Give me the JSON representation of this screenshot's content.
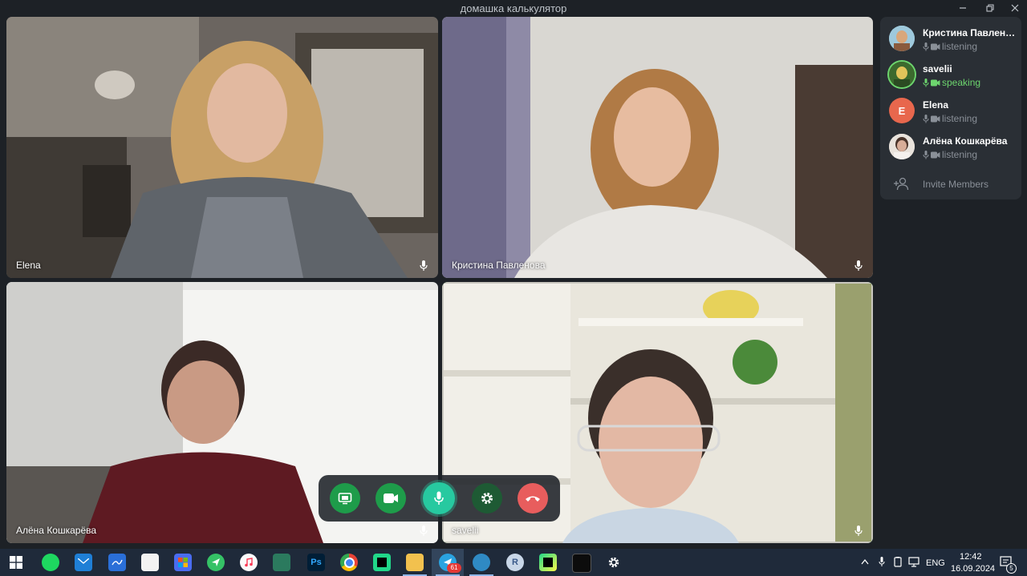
{
  "window": {
    "title": "домашка калькулятор"
  },
  "tiles": [
    {
      "name": "Elena"
    },
    {
      "name": "Кристина Павленова"
    },
    {
      "name": "Алёна Кошкарёва"
    },
    {
      "name": "savelii"
    }
  ],
  "members": [
    {
      "name": "Кристина Павленова",
      "status": "listening"
    },
    {
      "name": "savelii",
      "status": "speaking"
    },
    {
      "name": "Elena",
      "status": "listening",
      "initial": "E"
    },
    {
      "name": "Алёна Кошкарёва",
      "status": "listening"
    }
  ],
  "invite_label": "Invite Members",
  "controls": {
    "share_screen": "share-screen-icon",
    "camera": "video-camera-icon",
    "microphone": "microphone-icon",
    "settings": "gear-icon",
    "end_call": "hang-up-icon"
  },
  "colors": {
    "speaking_accent": "#6dd56e",
    "end_call": "#e85d5d",
    "camera_on": "#1e9c4a"
  },
  "taskbar": {
    "telegram_badge": "61",
    "store_letter": "R",
    "photoshop_label": "Ps",
    "language": "ENG",
    "time": "12:42",
    "date": "16.09.2024",
    "notifications_count": "5"
  }
}
